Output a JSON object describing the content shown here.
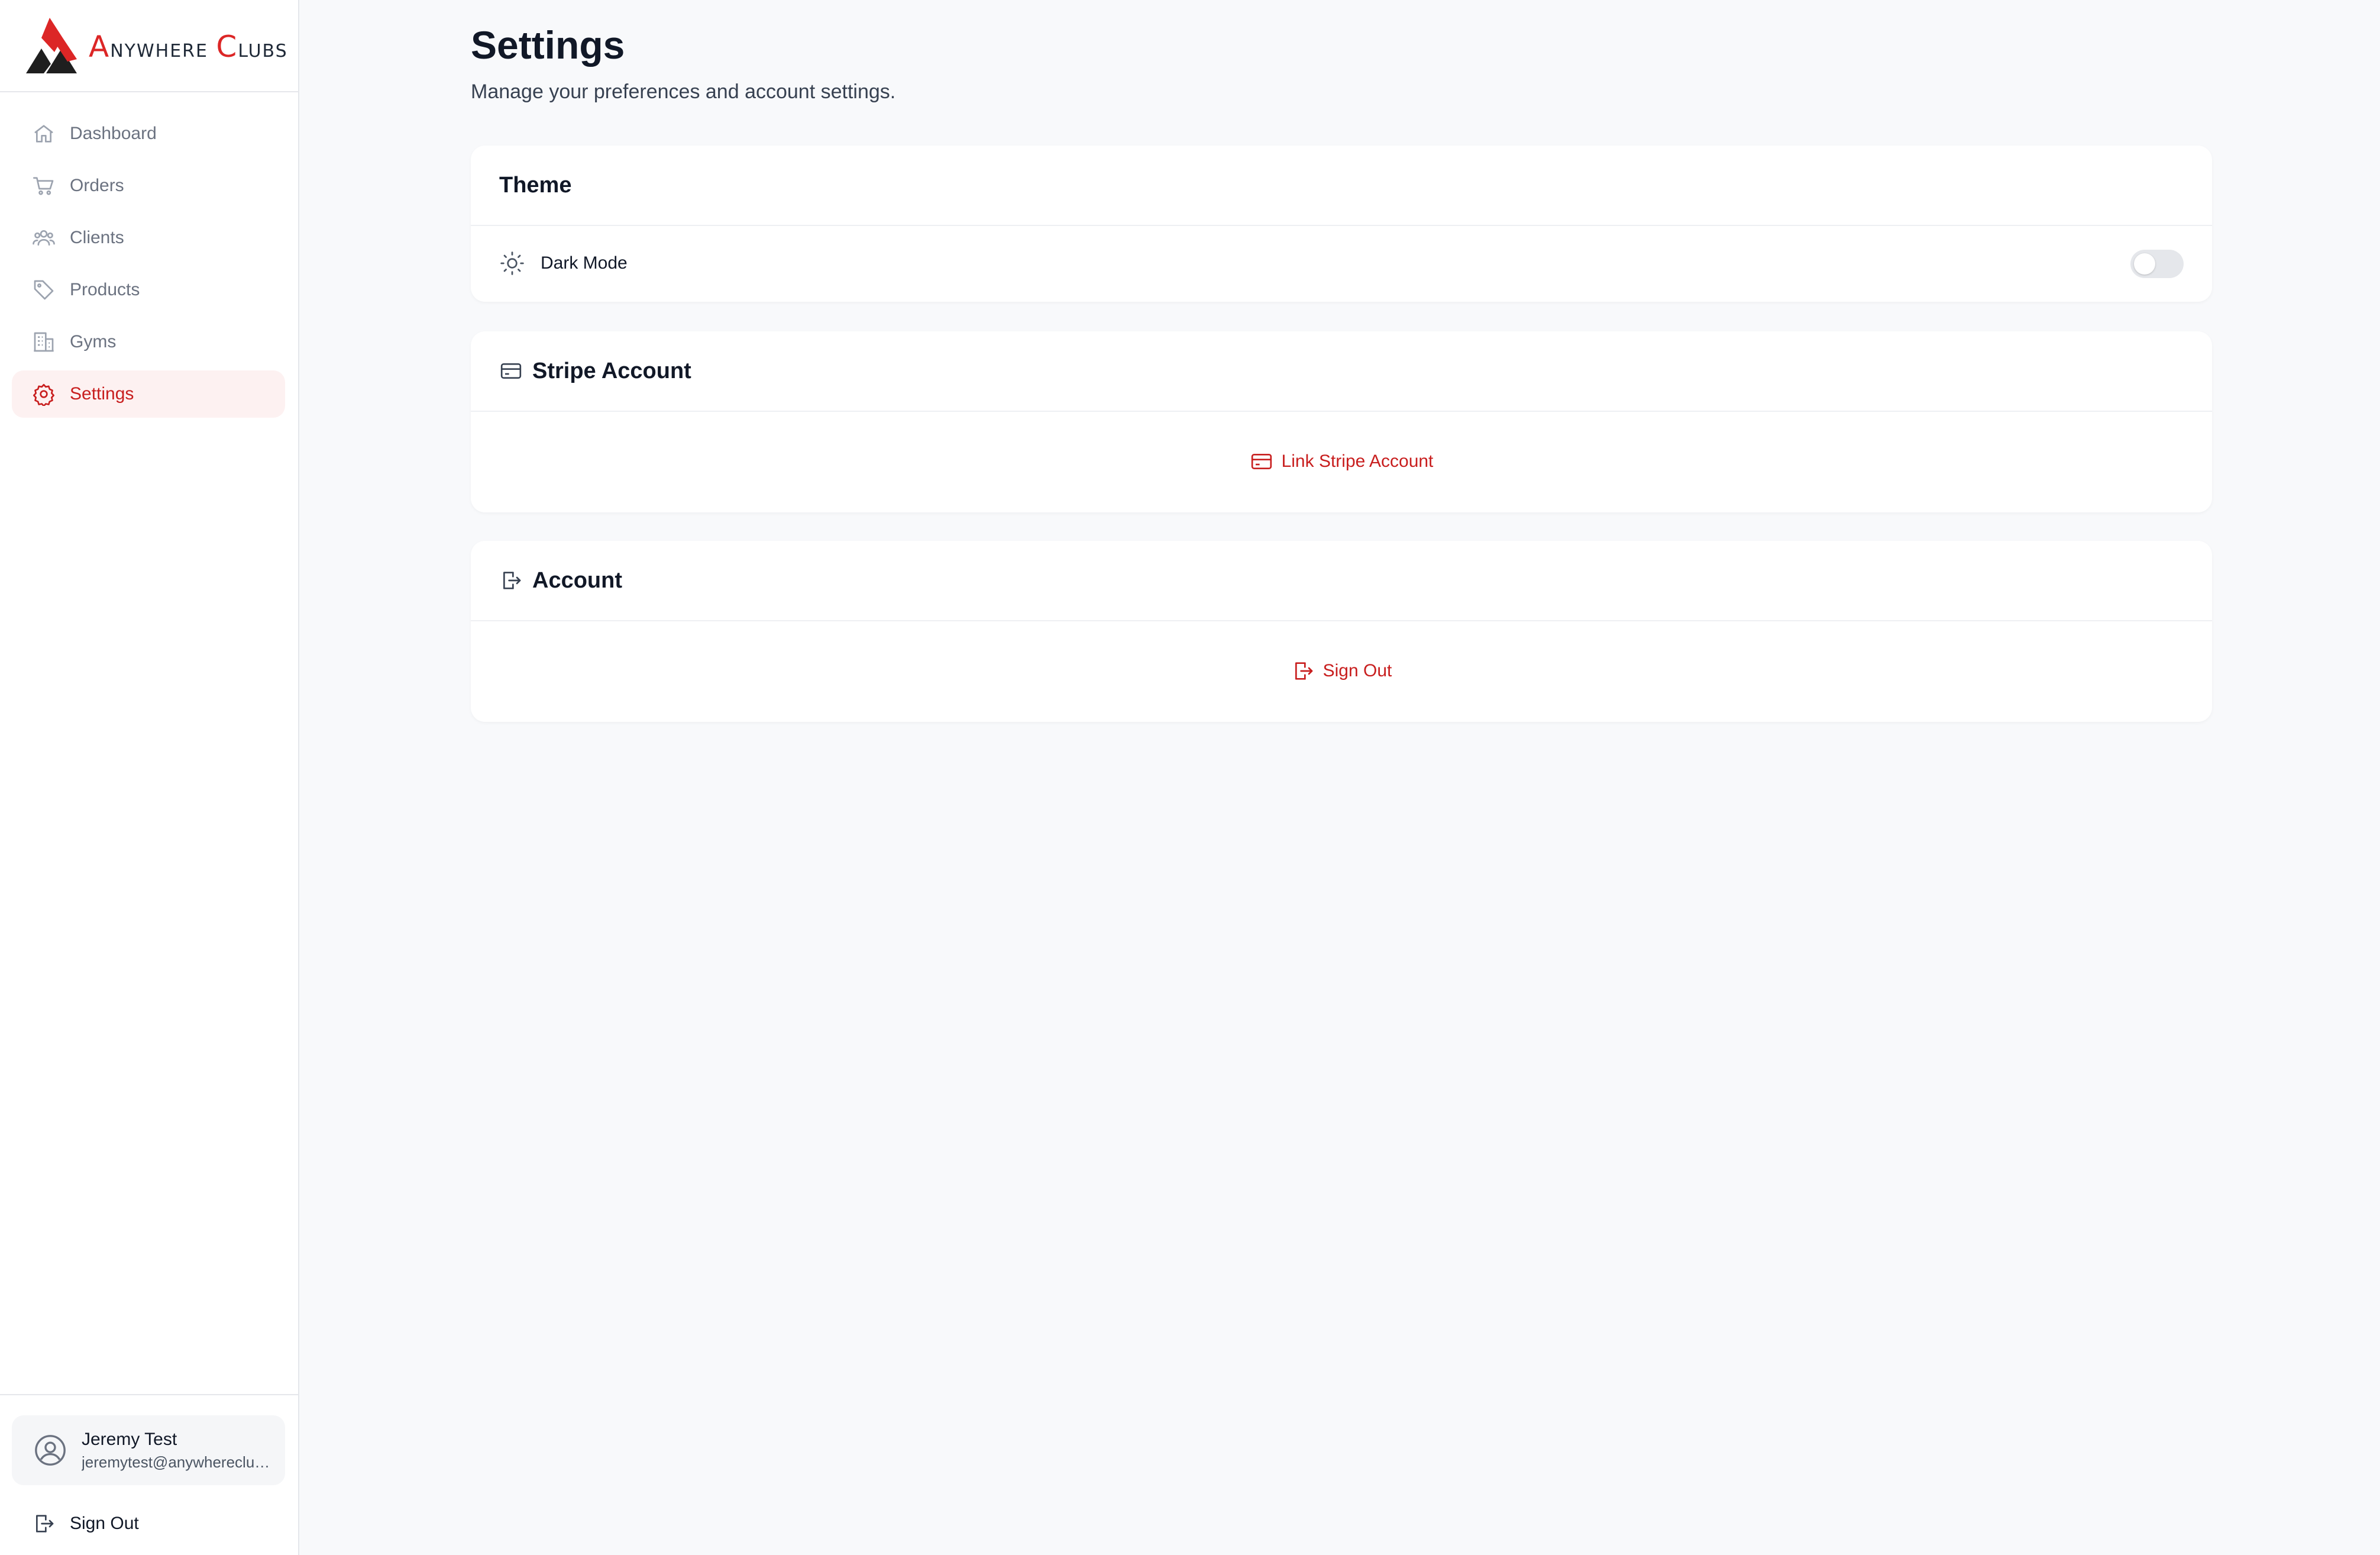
{
  "brand": {
    "name_first_cap": "A",
    "name_first_rest": "NYWHERE",
    "name_second_cap": "C",
    "name_second_rest": "LUBS",
    "accent_color": "#dc2626"
  },
  "sidebar": {
    "items": [
      {
        "label": "Dashboard",
        "icon": "home-icon",
        "active": false
      },
      {
        "label": "Orders",
        "icon": "cart-icon",
        "active": false
      },
      {
        "label": "Clients",
        "icon": "users-icon",
        "active": false
      },
      {
        "label": "Products",
        "icon": "tag-icon",
        "active": false
      },
      {
        "label": "Gyms",
        "icon": "building-icon",
        "active": false
      },
      {
        "label": "Settings",
        "icon": "gear-icon",
        "active": true
      }
    ],
    "user": {
      "name": "Jeremy Test",
      "email": "jeremytest@anywhereclubs.com"
    },
    "sign_out_label": "Sign Out"
  },
  "main": {
    "title": "Settings",
    "subtitle": "Manage your preferences and account settings.",
    "theme_card": {
      "title": "Theme",
      "dark_mode_label": "Dark Mode",
      "dark_mode_enabled": false
    },
    "stripe_card": {
      "title": "Stripe Account",
      "link_label": "Link Stripe Account"
    },
    "account_card": {
      "title": "Account",
      "sign_out_label": "Sign Out"
    }
  }
}
